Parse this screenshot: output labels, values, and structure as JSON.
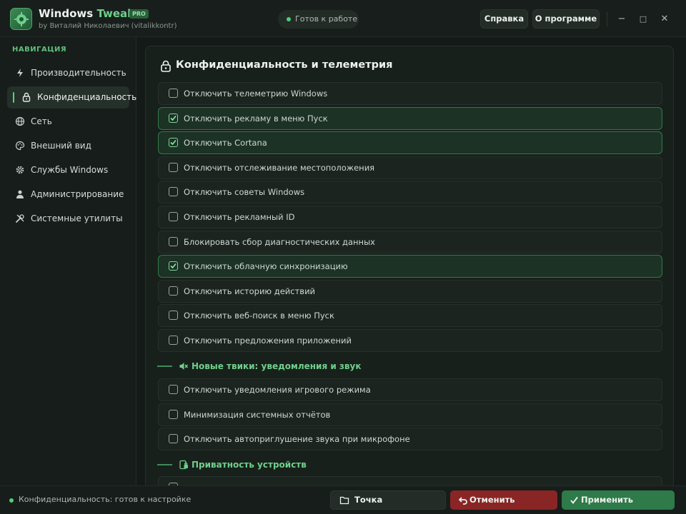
{
  "window": {
    "title_main": "Windows",
    "title_accent": "Tweaks",
    "badge": "PRO",
    "author": "by Виталий Николаевич (vitalikkontr)",
    "status": "Готов к работе",
    "help_label": "Справка",
    "about_label": "О программе",
    "minimize_glyph": "−",
    "maximize_glyph": "□",
    "close_glyph": "✕"
  },
  "sidebar": {
    "heading": "НАВИГАЦИЯ",
    "items": [
      {
        "label": "Производительность",
        "icon": "lightning-icon",
        "active": false
      },
      {
        "label": "Конфиденциальность",
        "icon": "lock-icon",
        "active": true
      },
      {
        "label": "Сеть",
        "icon": "globe-icon",
        "active": false
      },
      {
        "label": "Внешний вид",
        "icon": "palette-icon",
        "active": false
      },
      {
        "label": "Службы Windows",
        "icon": "gear-icon",
        "active": false
      },
      {
        "label": "Администрирование",
        "icon": "admin-icon",
        "active": false
      },
      {
        "label": "Системные утилиты",
        "icon": "tools-icon",
        "active": false
      }
    ]
  },
  "main": {
    "title": "Конфиденциальность и телеметрия",
    "options": [
      {
        "label": "Отключить телеметрию Windows",
        "checked": false
      },
      {
        "label": "Отключить рекламу в меню Пуск",
        "checked": true
      },
      {
        "label": "Отключить Cortana",
        "checked": true
      },
      {
        "label": "Отключить отслеживание местоположения",
        "checked": false
      },
      {
        "label": "Отключить советы Windows",
        "checked": false
      },
      {
        "label": "Отключить рекламный ID",
        "checked": false
      },
      {
        "label": "Блокировать сбор диагностических данных",
        "checked": false
      },
      {
        "label": "Отключить облачную синхронизацию",
        "checked": true
      },
      {
        "label": "Отключить историю действий",
        "checked": false
      },
      {
        "label": "Отключить веб-поиск в меню Пуск",
        "checked": false
      },
      {
        "label": "Отключить предложения приложений",
        "checked": false
      }
    ],
    "section2_title": "Новые твики: уведомления и звук",
    "section2_options": [
      {
        "label": "Отключить уведомления игрового режима",
        "checked": false
      },
      {
        "label": "Минимизация системных отчётов",
        "checked": false
      },
      {
        "label": "Отключить автоприглушение звука при микрофоне",
        "checked": false
      }
    ],
    "section3_title": "Приватность устройств"
  },
  "statusbar": {
    "text": "Конфиденциальность: готов к настройке",
    "restore_label": "Точка восстановления",
    "revert_label": "Отменить изменения",
    "apply_label": "Применить изменения"
  },
  "colors": {
    "accent": "#6fcf8a",
    "danger": "#8a2525",
    "apply": "#2e7a48",
    "background": "#141a17"
  }
}
